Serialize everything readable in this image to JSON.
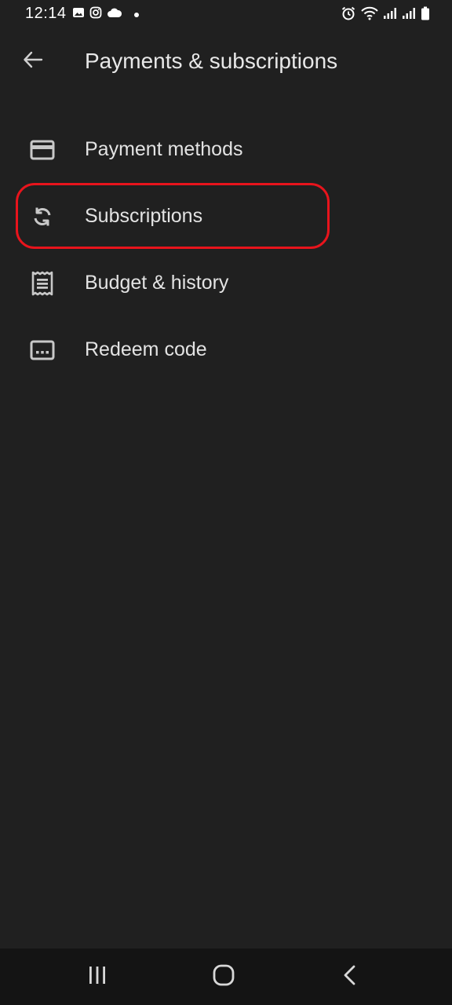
{
  "status_bar": {
    "time": "12:14",
    "left_icons": [
      "image-icon",
      "instagram-icon",
      "cloud-icon",
      "dot-icon"
    ],
    "right_icons": [
      "alarm-icon",
      "wifi-icon",
      "signal-icon",
      "signal-icon",
      "battery-icon"
    ]
  },
  "app_bar": {
    "back_icon": "arrow-left-icon",
    "title": "Payments & subscriptions"
  },
  "menu": {
    "items": [
      {
        "label": "Payment methods",
        "icon": "credit-card-icon"
      },
      {
        "label": "Subscriptions",
        "icon": "sync-icon",
        "highlighted": true
      },
      {
        "label": "Budget & history",
        "icon": "receipt-icon"
      },
      {
        "label": "Redeem code",
        "icon": "redeem-code-icon"
      }
    ]
  },
  "nav_bar": {
    "buttons": [
      "recent-apps-icon",
      "home-icon",
      "back-icon"
    ]
  },
  "colors": {
    "background": "#202020",
    "text": "#e3e3e3",
    "highlight": "#e8141c",
    "nav_background": "#141414"
  }
}
